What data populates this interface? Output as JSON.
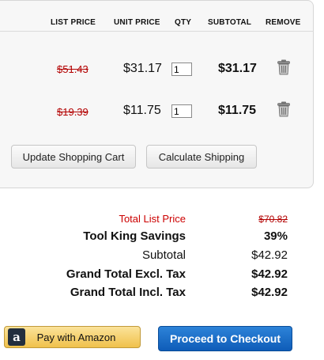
{
  "cart": {
    "headers": {
      "list_price": "LIST PRICE",
      "unit_price": "UNIT PRICE",
      "qty": "QTY",
      "subtotal": "SUBTOTAL",
      "remove": "REMOVE"
    },
    "items": [
      {
        "list_price": "$51.43",
        "unit_price": "$31.17",
        "qty": "1",
        "subtotal": "$31.17",
        "remove_icon": "trash-icon"
      },
      {
        "list_price": "$19.39",
        "unit_price": "$11.75",
        "qty": "1",
        "subtotal": "$11.75",
        "remove_icon": "trash-icon"
      }
    ],
    "update_label": "Update Shopping Cart",
    "shipping_label": "Calculate Shipping"
  },
  "summary": {
    "total_list_price_label": "Total List Price",
    "total_list_price_value": "$70.82",
    "savings_label": "Tool King Savings",
    "savings_value": "39%",
    "subtotal_label": "Subtotal",
    "subtotal_value": "$42.92",
    "grand_excl_label": "Grand Total Excl. Tax",
    "grand_excl_value": "$42.92",
    "grand_incl_label": "Grand Total Incl. Tax",
    "grand_incl_value": "$42.92"
  },
  "actions": {
    "amazon_label": "Pay with Amazon",
    "amazon_icon": "amazon-logo-icon",
    "checkout_label": "Proceed to Checkout"
  },
  "colors": {
    "list_price_red": "#b30000",
    "checkout_blue": "#1468c6",
    "amazon_yellow": "#f0c14b"
  }
}
